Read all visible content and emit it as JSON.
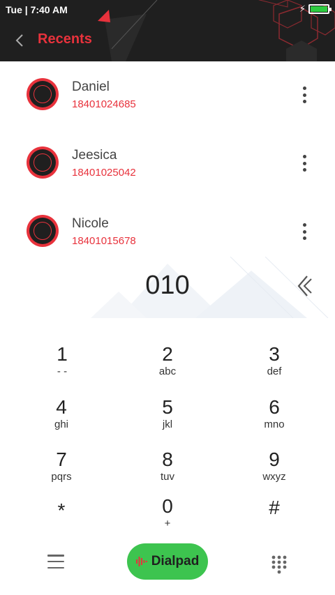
{
  "status_bar": {
    "day": "Tue",
    "time": "7:40 AM"
  },
  "header": {
    "title": "Recents"
  },
  "contacts": [
    {
      "name": "Daniel",
      "number": "18401024685"
    },
    {
      "name": "Jeesica",
      "number": "18401025042"
    },
    {
      "name": "Nicole",
      "number": "18401015678"
    }
  ],
  "dial_input": {
    "value": "010"
  },
  "keypad": [
    {
      "digit": "1",
      "letters": "- -"
    },
    {
      "digit": "2",
      "letters": "abc"
    },
    {
      "digit": "3",
      "letters": "def"
    },
    {
      "digit": "4",
      "letters": "ghi"
    },
    {
      "digit": "5",
      "letters": "jkl"
    },
    {
      "digit": "6",
      "letters": "mno"
    },
    {
      "digit": "7",
      "letters": "pqrs"
    },
    {
      "digit": "8",
      "letters": "tuv"
    },
    {
      "digit": "9",
      "letters": "wxyz"
    },
    {
      "digit": "*",
      "letters": ""
    },
    {
      "digit": "0",
      "letters": "+"
    },
    {
      "digit": "#",
      "letters": ""
    }
  ],
  "bottom_bar": {
    "dialpad_label": "Dialpad"
  },
  "icons": {
    "back": "chevron-left-icon",
    "more": "more-vertical-icon",
    "delete": "backspace-icon",
    "menu": "menu-icon",
    "dialpad_wave": "sound-wave-icon",
    "grid": "dialpad-grid-icon",
    "battery": "battery-icon",
    "charging": "bolt-icon"
  },
  "colors": {
    "accent": "#e8323c",
    "header_bg": "#1f1f1f",
    "dialpad_button": "#3dc44f",
    "battery_fill": "#2ecc40"
  }
}
